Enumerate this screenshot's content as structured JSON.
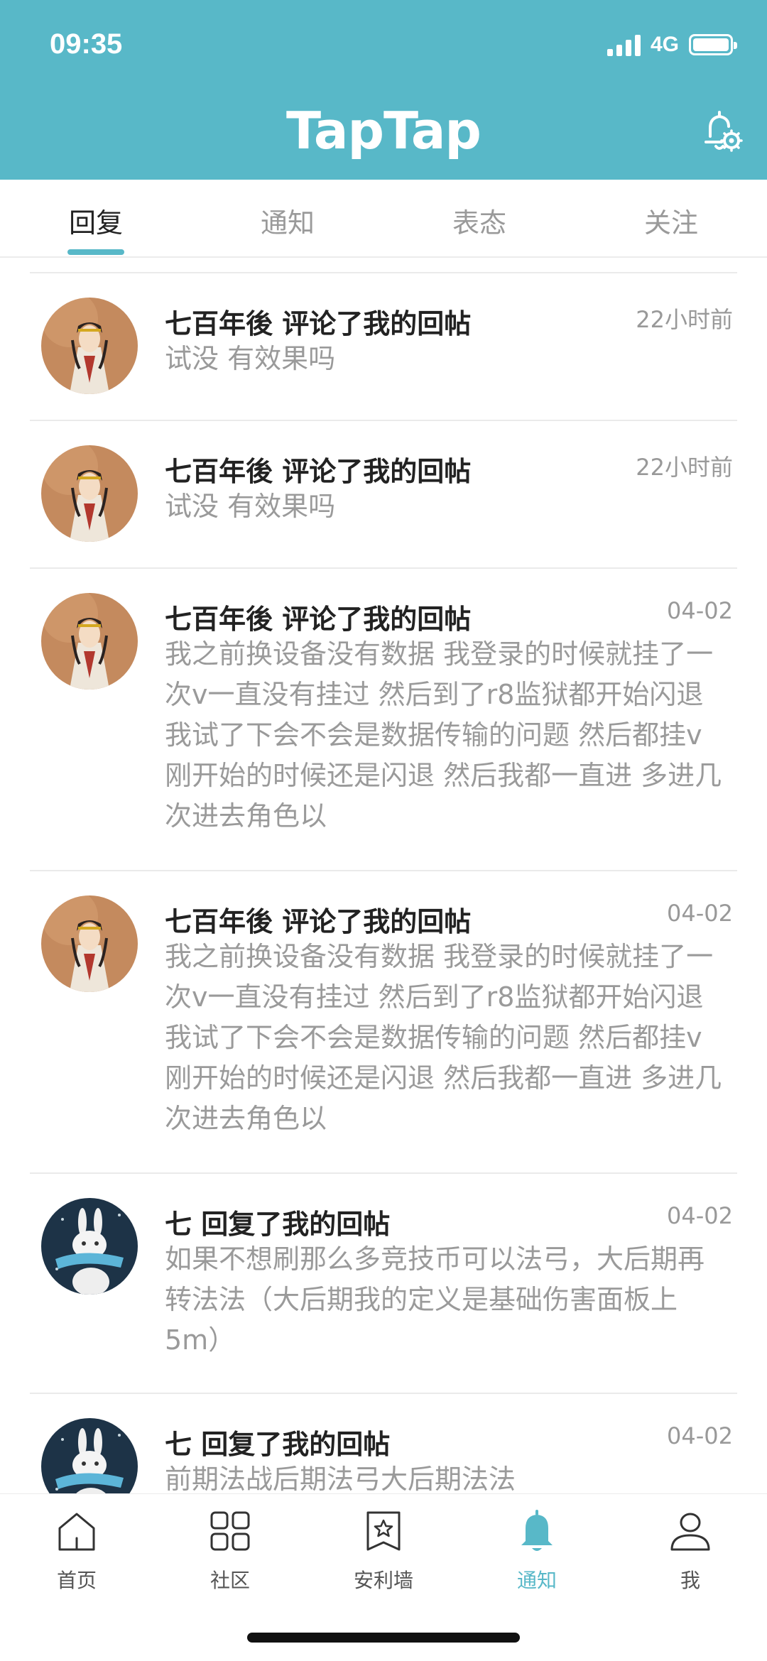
{
  "status_bar": {
    "time": "09:35",
    "network": "4G"
  },
  "header": {
    "title": "TapTap",
    "settings_icon": "bell-settings-icon"
  },
  "tabs": [
    {
      "label": "回复",
      "active": true
    },
    {
      "label": "通知",
      "active": false
    },
    {
      "label": "表态",
      "active": false
    },
    {
      "label": "关注",
      "active": false
    }
  ],
  "notifications": [
    {
      "title": "七百年後 评论了我的回帖",
      "time": "22小时前",
      "body": "试没  有效果吗",
      "avatar": "lady-avatar"
    },
    {
      "title": "七百年後 评论了我的回帖",
      "time": "22小时前",
      "body": "试没  有效果吗",
      "avatar": "lady-avatar"
    },
    {
      "title": "七百年後 评论了我的回帖",
      "time": "04-02",
      "body": "我之前换设备没有数据 我登录的时候就挂了一次v一直没有挂过  然后到了r8监狱都开始闪退  我试了下会不会是数据传输的问题  然后都挂v  刚开始的时候还是闪退  然后我都一直进  多进几次进去角色以",
      "avatar": "lady-avatar"
    },
    {
      "title": "七百年後 评论了我的回帖",
      "time": "04-02",
      "body": "我之前换设备没有数据 我登录的时候就挂了一次v一直没有挂过  然后到了r8监狱都开始闪退  我试了下会不会是数据传输的问题  然后都挂v  刚开始的时候还是闪退  然后我都一直进  多进几次进去角色以",
      "avatar": "lady-avatar"
    },
    {
      "title": "七 回复了我的回帖",
      "time": "04-02",
      "body": "如果不想刷那么多竞技币可以法弓，大后期再转法法（大后期我的定义是基础伤害面板上5m）",
      "avatar": "rabbit-avatar"
    },
    {
      "title": "七 回复了我的回帖",
      "time": "04-02",
      "body": "前期法战后期法弓大后期法法",
      "avatar": "rabbit-avatar"
    }
  ],
  "bottom_nav": [
    {
      "label": "首页",
      "icon": "home-icon",
      "active": false
    },
    {
      "label": "社区",
      "icon": "grid-icon",
      "active": false
    },
    {
      "label": "安利墙",
      "icon": "bookmark-star-icon",
      "active": false
    },
    {
      "label": "通知",
      "icon": "bell-icon",
      "active": true
    },
    {
      "label": "我",
      "icon": "user-icon",
      "active": false
    }
  ],
  "colors": {
    "brand": "#58b8c8",
    "text": "#222222",
    "muted": "#9a9a9a"
  }
}
